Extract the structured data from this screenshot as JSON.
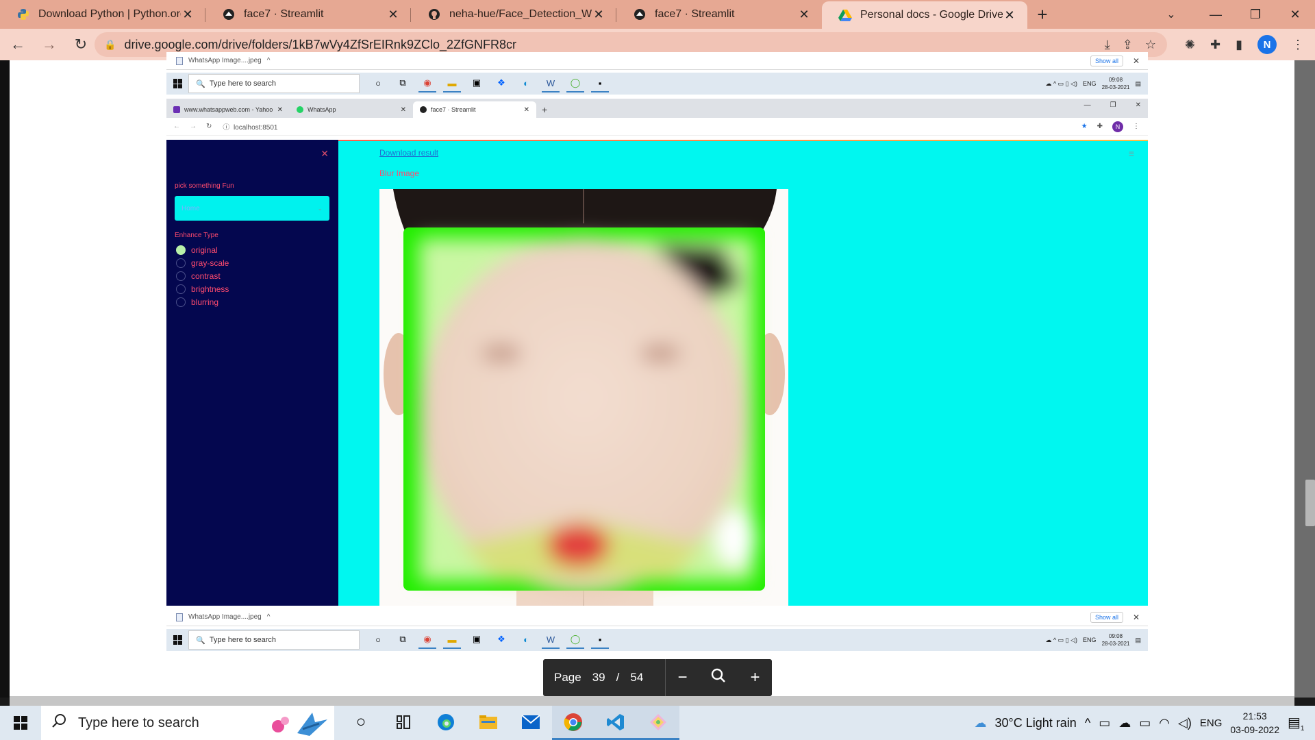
{
  "browser": {
    "tabs": [
      {
        "title": "Download Python | Python.org",
        "icon": "python-icon",
        "active": false
      },
      {
        "title": "face7 · Streamlit",
        "icon": "streamlit-icon",
        "active": false
      },
      {
        "title": "neha-hue/Face_Detection_WebA",
        "icon": "github-icon",
        "active": false
      },
      {
        "title": "face7 · Streamlit",
        "icon": "streamlit-icon",
        "active": false
      },
      {
        "title": "Personal docs - Google Drive",
        "icon": "google-drive-icon",
        "active": true
      }
    ],
    "new_tab": "+",
    "url": "drive.google.com/drive/folders/1kB7wVy4ZfSrEIRnk9ZClo_2ZfGNFR8cr",
    "profile_initial": "N"
  },
  "embedded": {
    "download_file": "WhatsApp Image....jpeg",
    "show_all": "Show all",
    "search_placeholder": "Type here to search",
    "tray_lang": "ENG",
    "tray_time": "09:08",
    "tray_date": "28-03-2021",
    "mini_tabs": [
      {
        "title": "www.whatsappweb.com - Yahoo",
        "color": "#6b2fb3"
      },
      {
        "title": "WhatsApp",
        "color": "#25d366"
      },
      {
        "title": "face7 · Streamlit",
        "color": "#222222"
      }
    ],
    "mini_url": "localhost:8501",
    "mini_profile": "N",
    "app": {
      "sidebar_label": "pick something Fun",
      "select_value": "Home",
      "enhance_label": "Enhance Type",
      "options": [
        "original",
        "gray-scale",
        "contrast",
        "brightness",
        "blurring"
      ],
      "selected_option": "original",
      "download_link": "Download result",
      "section_title": "Blur Image"
    }
  },
  "pdf_controls": {
    "page_label": "Page",
    "current_page": "39",
    "separator": "/",
    "total_pages": "54"
  },
  "taskbar": {
    "search_placeholder": "Type here to search",
    "weather": "30°C  Light rain",
    "language": "ENG",
    "time": "21:53",
    "date": "03-09-2022",
    "notification_count": "1"
  },
  "colors": {
    "tabbar": "#e6a893",
    "addrbar": "#f7d5ca",
    "app_background": "#00f7f0",
    "sidebar": "#04074f",
    "accent_text": "#ff4b6e",
    "face_box": "#22ee00"
  }
}
